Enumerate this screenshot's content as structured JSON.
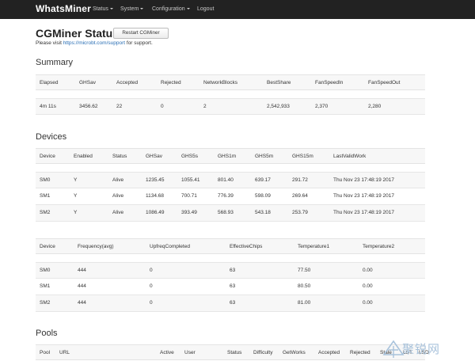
{
  "navbar": {
    "brand": "WhatsMiner",
    "items": [
      {
        "label": "Status",
        "dropdown": true
      },
      {
        "label": "System",
        "dropdown": true
      },
      {
        "label": "Configuration",
        "dropdown": true
      },
      {
        "label": "Logout",
        "dropdown": false
      }
    ]
  },
  "header": {
    "title": "CGMiner Status",
    "restart_label": "Restart CGMiner",
    "support_prefix": "Please visit ",
    "support_link": "https://microbt.com/support",
    "support_suffix": " for support."
  },
  "summary": {
    "title": "Summary",
    "columns": [
      "Elapsed",
      "GHSav",
      "Accepted",
      "Rejected",
      "NetworkBlocks",
      "BestShare",
      "FanSpeedIn",
      "FanSpeedOut"
    ],
    "row": [
      "4m 11s",
      "3456.62",
      "22",
      "0",
      "2",
      "2,542,933",
      "2,370",
      "2,280"
    ]
  },
  "devices": {
    "title": "Devices",
    "columns": [
      "Device",
      "Enabled",
      "Status",
      "GHSav",
      "GHS5s",
      "GHS1m",
      "GHS5m",
      "GHS15m",
      "LastValidWork"
    ],
    "rows": [
      [
        "SM0",
        "Y",
        "Alive",
        "1235.45",
        "1055.41",
        "801.40",
        "639.17",
        "291.72",
        "Thu Nov 23 17:48:19 2017"
      ],
      [
        "SM1",
        "Y",
        "Alive",
        "1134.68",
        "700.71",
        "776.39",
        "598.09",
        "269.64",
        "Thu Nov 23 17:48:19 2017"
      ],
      [
        "SM2",
        "Y",
        "Alive",
        "1086.49",
        "393.49",
        "568.93",
        "543.18",
        "253.79",
        "Thu Nov 23 17:48:19 2017"
      ]
    ]
  },
  "devices2": {
    "columns": [
      "Device",
      "Frequency(avg)",
      "UpfreqCompleted",
      "EffectiveChips",
      "Temperature1",
      "Temperature2"
    ],
    "rows": [
      [
        "SM0",
        "444",
        "0",
        "63",
        "77.50",
        "0.00"
      ],
      [
        "SM1",
        "444",
        "0",
        "63",
        "80.50",
        "0.00"
      ],
      [
        "SM2",
        "444",
        "0",
        "63",
        "81.00",
        "0.00"
      ]
    ]
  },
  "pools": {
    "title": "Pools",
    "columns": [
      "Pool",
      "URL",
      "Active",
      "User",
      "Status",
      "Difficulty",
      "GetWorks",
      "Accepted",
      "Rejected",
      "Stale",
      "LST",
      "LSD"
    ]
  },
  "watermark": {
    "text": "聚锐网"
  },
  "colors": {
    "navbar_bg": "#222222",
    "link": "#2a6fb5",
    "header_row_bg": "#f7f7f7"
  }
}
